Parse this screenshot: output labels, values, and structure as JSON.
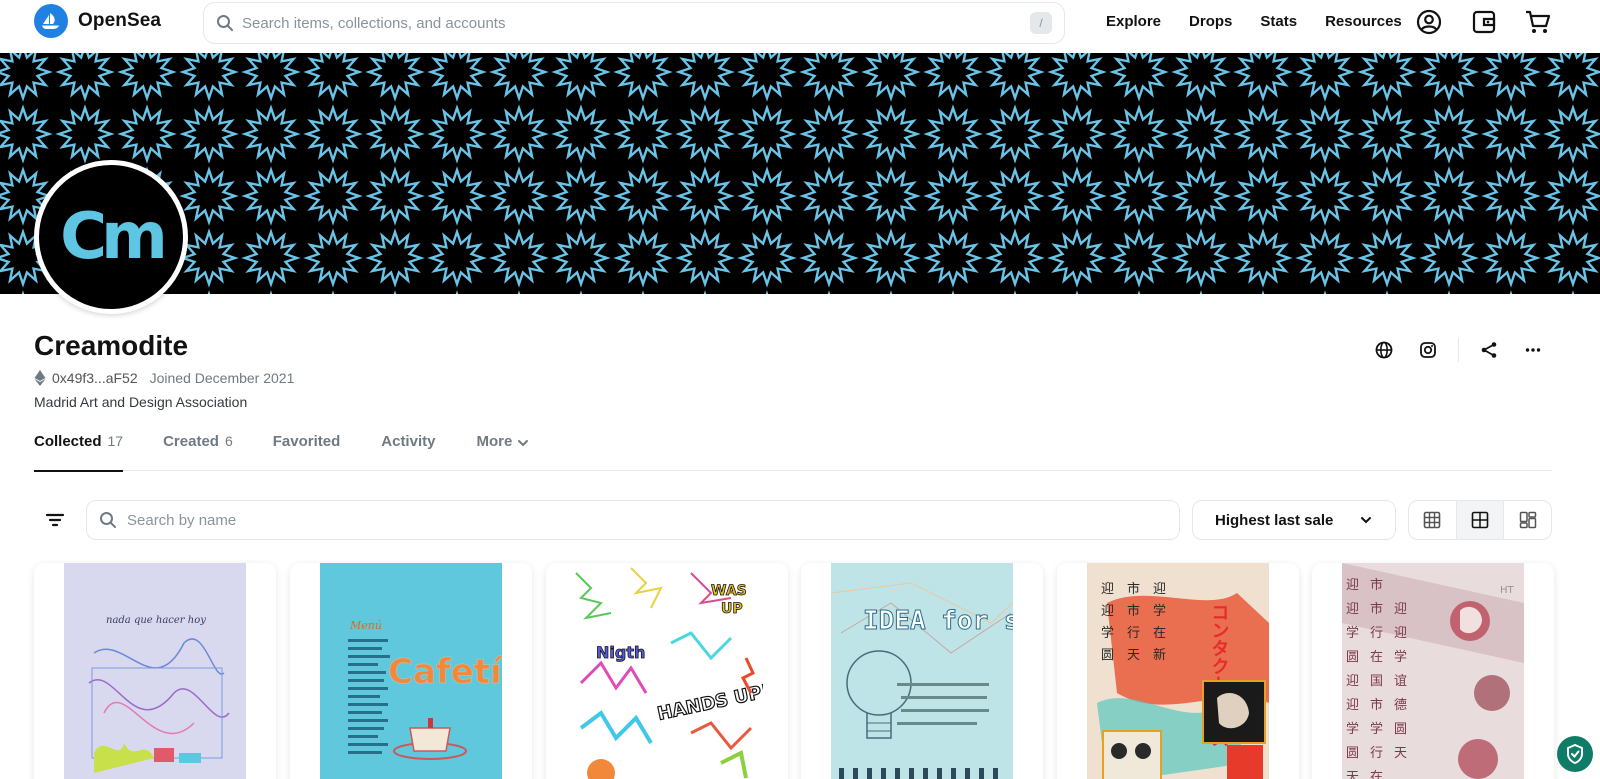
{
  "header": {
    "brand": "OpenSea",
    "search_placeholder": "Search items, collections, and accounts",
    "search_shortcut": "/",
    "nav": [
      "Explore",
      "Drops",
      "Stats",
      "Resources"
    ],
    "icons": [
      "account-icon",
      "wallet-icon",
      "cart-icon"
    ]
  },
  "profile": {
    "name": "Creamodite",
    "avatar_text": "Cm",
    "address": "0x49f3...aF52",
    "joined": "Joined December 2021",
    "bio": "Madrid Art and Design Association",
    "action_icons": [
      "globe-icon",
      "instagram-icon",
      "share-icon",
      "more-icon"
    ]
  },
  "tabs": [
    {
      "label": "Collected",
      "count": "17",
      "active": true
    },
    {
      "label": "Created",
      "count": "6",
      "active": false
    },
    {
      "label": "Favorited",
      "count": "",
      "active": false
    },
    {
      "label": "Activity",
      "count": "",
      "active": false
    },
    {
      "label": "More",
      "count": "",
      "active": false
    }
  ],
  "filters": {
    "search_placeholder": "Search by name",
    "sort_label": "Highest last sale",
    "view_modes": [
      "large-grid",
      "medium-grid",
      "mosaic"
    ],
    "active_view": "medium-grid"
  },
  "items": [
    {
      "art_text": "nada que hacer hoy",
      "bg": "#d8d9ee"
    },
    {
      "art_text": "Cafetín",
      "bg": "#60c8dc"
    },
    {
      "art_text": "HANDS UP!",
      "bg": "#ffffff"
    },
    {
      "art_text": "IDEA for sale",
      "bg": "#bfe4e8"
    },
    {
      "art_text": "コンタクトレンズ",
      "bg": "#f2a49a"
    },
    {
      "art_text": "",
      "bg": "#d9c9cc"
    }
  ],
  "colors": {
    "brand": "#2081e2",
    "banner_star": "#6ac4e8",
    "avatar_text": "#5ec5e3"
  }
}
